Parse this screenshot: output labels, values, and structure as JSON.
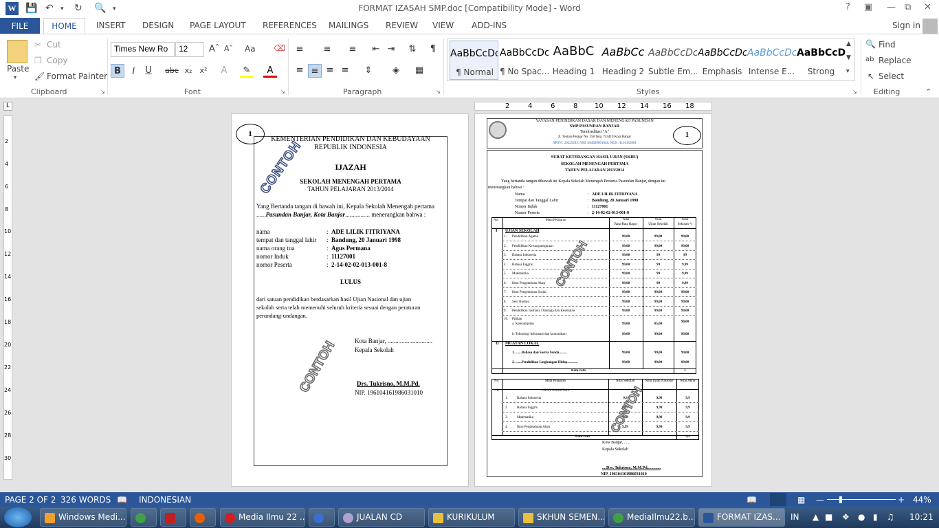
{
  "window": {
    "title": "FORMAT IZASAH SMP.doc [Compatibility Mode] - Word",
    "word_icon": "W",
    "help": "?",
    "signin": "Sign in"
  },
  "qat": {
    "save_icon": "save-icon",
    "undo_icon": "undo-icon",
    "redo_icon": "redo-icon",
    "preview_icon": "print-preview-icon"
  },
  "tabs": [
    "FILE",
    "HOME",
    "INSERT",
    "DESIGN",
    "PAGE LAYOUT",
    "REFERENCES",
    "MAILINGS",
    "REVIEW",
    "VIEW",
    "ADD-INS"
  ],
  "clipboard": {
    "paste": "Paste",
    "cut": "Cut",
    "copy": "Copy",
    "format_painter": "Format Painter",
    "group": "Clipboard"
  },
  "font": {
    "name": "Times New Ro",
    "size": "12",
    "group": "Font",
    "bold": "B",
    "italic": "I",
    "underline": "U",
    "strike": "abc",
    "sub": "x₂",
    "sup": "x²",
    "aa": "Aa"
  },
  "paragraph": {
    "group": "Paragraph"
  },
  "styles": {
    "group": "Styles",
    "items": [
      {
        "preview": "AaBbCcDc",
        "name": "¶ Normal"
      },
      {
        "preview": "AaBbCcDc",
        "name": "¶ No Spac..."
      },
      {
        "preview": "AaBbC",
        "name": "Heading 1"
      },
      {
        "preview": "AaBbCc",
        "name": "Heading 2"
      },
      {
        "preview": "AaBbCcDc",
        "name": "Subtle Em..."
      },
      {
        "preview": "AaBbCcDc",
        "name": "Emphasis"
      },
      {
        "preview": "AaBbCcDc",
        "name": "Intense E..."
      },
      {
        "preview": "AaBbCcDc",
        "name": "Strong"
      }
    ]
  },
  "editing": {
    "group": "Editing",
    "find": "Find",
    "replace": "Replace",
    "select": "Select"
  },
  "ruler_h": [
    "2",
    "4",
    "6",
    "8",
    "10",
    "12",
    "14",
    "16",
    "18"
  ],
  "ruler_v": [
    "2",
    "4",
    "6",
    "8",
    "10",
    "12",
    "14",
    "16",
    "18",
    "20",
    "22",
    "24",
    "26",
    "28",
    "30"
  ],
  "ijazah": {
    "number": "1",
    "ministry": "KEMENTERIAN PENDIDIKAN DAN KEBUDAYAAN",
    "republic": "REPUBLIK INDONESIA",
    "title": "IJAZAH",
    "school_level": "SEKOLAH MENENGAH PERTAMA",
    "year": "TAHUN PELAJARAN 2013/2014",
    "intro1": "Yang Bertanda tangan di bawah ini, Kepala Sekolah Menengah pertama",
    "intro2_pre": "......",
    "intro2_school": "Pasundan Banjar,  Kota Banjar",
    "intro2_post": "................ menerangkan bahwa :",
    "fields": [
      {
        "label": "nama",
        "value": "ADE LILIK FITRIYANA"
      },
      {
        "label": "tempat dan tanggal lahir",
        "value": "Bandung, 20 Januari 1998"
      },
      {
        "label": "nama orang tua",
        "value": "Agus Permana"
      },
      {
        "label": "nomor Induk",
        "value": "11127001"
      },
      {
        "label": "nomor Peserta",
        "value": "2-14-02-02-013-001-8"
      }
    ],
    "result": "LULUS",
    "body1": "dari satuan pendidikan berdasarkan hasil Ujian Nasional dan ujian",
    "body2": "sekolah serta telah memenuhi seluruh kriteria sesuai dengan peraturan",
    "body3": "perundang-undangan.",
    "place": "Kota Banjar, .............................",
    "position": "Kepala Sekolah",
    "signer": "Drs. Tukrisno, M.M.Pd.",
    "nip": "NIP. 196104161986031010",
    "watermark": "CONTOH"
  },
  "skhu": {
    "number": "1",
    "foundation": "YAYASAN PENDIDIKAN DASAR DAN MENENGAH PASUNDAN",
    "school": "SMP PASUNDAN  BANJAR",
    "accr": "Terakreditasi \"A\"",
    "address": "Jl. Tentara Pelajar No. 158 Telp. 745419 Kota Banjar",
    "npsn": "NPSN : 20225263, NSS :204026001048, NDS : B.16152001",
    "t1": "SURAT KETERANGAN HASIL UJIAN (SKHU)",
    "t2": "SEKOLAH MENENGAH PERTAMA",
    "t3": "TAHUN PELAJARAN 2013/2014",
    "intro1": "Yang bertanda tangan dibawah ini Kepala Sekolah Menengah Pertama Pasundan Banjar, dengan ini",
    "intro2": "menerangkan bahwa :",
    "fields": [
      {
        "label": "Nama",
        "value": "ADE LILIK FITRIYANA"
      },
      {
        "label": "Tempat dan Tanggal Lahir",
        "value": "Bandung, 20 Januari 1998"
      },
      {
        "label": "Nomor Induk",
        "value": "11127001"
      },
      {
        "label": "Nomor Peserta",
        "value": "2-14-02-02-013-001-8"
      }
    ],
    "h_no": "No.",
    "h_mapel": "Mata Pelajaran",
    "h_nilai1": "Nilai",
    "h_rata": "Rata-Rata Rapor",
    "h_nilai2": "Nilai",
    "h_ujian": "Ujian Sekolah",
    "h_nilai3": "Nilai",
    "h_sekolah": "Sekolah *)",
    "sec1": "UJIAN SEKOLAH",
    "sec1no": "I",
    "rows": [
      {
        "n": "1.",
        "s": "Pendidikan Agama",
        "a": "99,00",
        "b": "99,00",
        "c": "99,00"
      },
      {
        "n": "2.",
        "s": "Pendidikan Kewarganegaraan",
        "a": "99,00",
        "b": "99,00",
        "c": "99,00"
      },
      {
        "n": "3.",
        "s": "Bahasa Indonesia",
        "a": "99,00",
        "b": "99",
        "c": "99"
      },
      {
        "n": "4.",
        "s": "Bahasa Inggris",
        "a": "99,00",
        "b": "99",
        "c": "9,99"
      },
      {
        "n": "5.",
        "s": "Matematika",
        "a": "99,00",
        "b": "99",
        "c": "9,99"
      },
      {
        "n": "6.",
        "s": "Ilmu Pengetahuan Alam",
        "a": "99,00",
        "b": "99",
        "c": "9,99"
      },
      {
        "n": "7.",
        "s": "Ilmu Pengetahuan Sosial",
        "a": "99,00",
        "b": "99,00",
        "c": "99,00"
      },
      {
        "n": "8.",
        "s": "Seni Budaya",
        "a": "99,00",
        "b": "99,00",
        "c": "99,00"
      },
      {
        "n": "9.",
        "s": "Pendidikan Jasmani, Olahraga dan Kesehatan",
        "a": "99,00",
        "b": "99,00",
        "c": "99,00"
      }
    ],
    "r10": "10.",
    "pilihan": "Pilihan",
    "pa": "a.   Keterampilan",
    "pa_a": "99,00",
    "pa_b": "85,00",
    "pa_c": "90,00",
    "pb": "b.   Teknologi Informasi dan komunikasi",
    "pb_a": "99,00",
    "pb_b": "99,00",
    "pb_c": "99,00",
    "sec2no": "II",
    "sec2": "MUATAN LOKAL",
    "ml1": "1.   .......Bahasa dan Sastra Sunda.........",
    "ml1_a": "99,00",
    "ml1_b": "99,00",
    "ml1_c": "99,00",
    "ml2": "2.   .......Pendidikan Lingkungan Hidup............",
    "ml2_a": "99,00",
    "ml2_b": "99,00",
    "ml2_c": "99,00",
    "ratarata": "Rata-rata",
    "rr_val": "1",
    "h2_no": "No.",
    "h2_mapel": "Mata Pelajaran",
    "h2_ns": "Nilai Sekolah",
    "h2_nu": "Nilai Ujian Nasional",
    "h2_na": "Nilai Akhir",
    "sec3no": "III",
    "sec3": "UJIAN NASIONAL",
    "un": [
      {
        "n": "1.",
        "s": "Bahasa Indonesia",
        "a": "9,9",
        "b": "9,99",
        "c": "9,9"
      },
      {
        "n": "2.",
        "s": "Bahasa Inggris",
        "a": "9,99",
        "b": "9,99",
        "c": "9,9"
      },
      {
        "n": "3.",
        "s": "Matematika",
        "a": "9,99",
        "b": "9,99",
        "c": "9,9"
      },
      {
        "n": "4.",
        "s": "Ilmu Pengetahuan Alam",
        "a": "9,99",
        "b": "9,99",
        "c": "9,9"
      }
    ],
    "ratarata2": "Rata-rata",
    "rr2": "9,9",
    "place": "Kota Banjar, ......",
    "position": "Kepala Sekolah",
    "signer": "....Drs. Tukrisno, M.M.Pd.............",
    "nip": "NIP. 196104161986031010",
    "watermark": "CONTOH"
  },
  "status": {
    "page": "PAGE 2 OF 2",
    "words": "326 WORDS",
    "lang": "INDONESIAN",
    "zoom": "44%"
  },
  "taskbar": {
    "items": [
      "Windows Medi...",
      "",
      "",
      "",
      "Media Ilmu 22 ...",
      "",
      "JUALAN CD",
      "KURIKULUM",
      "SKHUN SEMEN...",
      "MediaIlmu22.b...",
      "FORMAT IZAS..."
    ],
    "lang": "IN",
    "clock": "10:21"
  },
  "colors": {
    "accent": "#2b579a",
    "taskbar": "#203a5c",
    "watermark": "#3c4f82"
  }
}
